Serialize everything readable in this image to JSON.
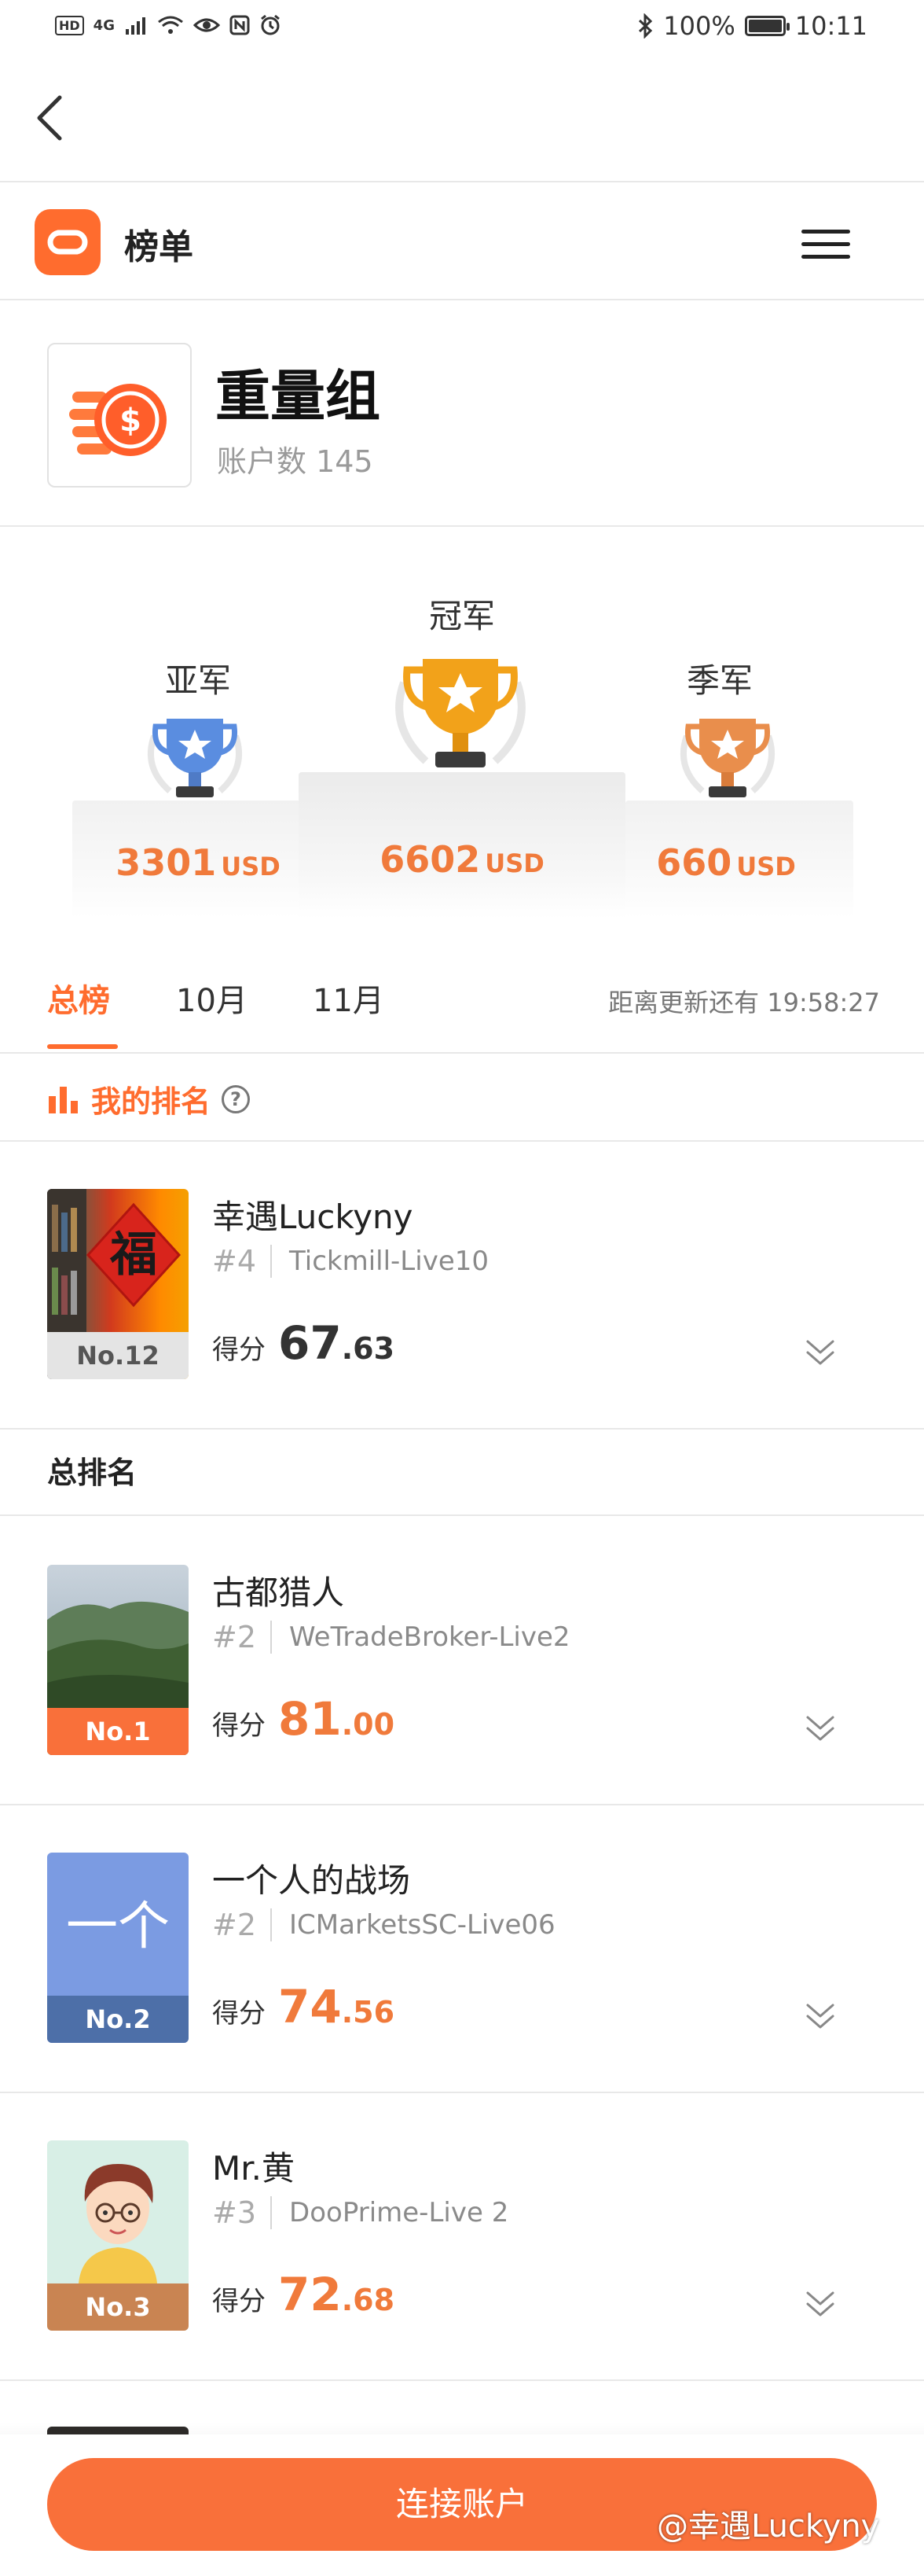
{
  "status_bar": {
    "left_chips": [
      "HD",
      "4G"
    ],
    "battery": "100%",
    "battery_level": 1.0,
    "time": "10:11"
  },
  "header": {
    "title": "榜单",
    "icons": {
      "back": "chevron-left-icon",
      "menu": "hamburger-menu-icon",
      "logo": "app-logo-icon"
    }
  },
  "group": {
    "name": "重量组",
    "account_count": "账户数 145",
    "icon": "dollar-coins-icon"
  },
  "podium": {
    "second": {
      "label": "亚军",
      "amount": "3301",
      "unit": "USD",
      "trophy_color": "#5a8de0"
    },
    "first": {
      "label": "冠军",
      "amount": "6602",
      "unit": "USD",
      "trophy_color": "#f2a21a"
    },
    "third": {
      "label": "季军",
      "amount": "660",
      "unit": "USD",
      "trophy_color": "#e98e4c"
    }
  },
  "tabs": [
    {
      "label": "总榜",
      "active": true
    },
    {
      "label": "10月",
      "active": false
    },
    {
      "label": "11月",
      "active": false
    }
  ],
  "countdown": "距离更新还有 19:58:27",
  "my_rank": {
    "label": "我的排名",
    "entry": {
      "name": "幸遇Luckyny",
      "rank_tag": "#4",
      "account": "Tickmill-Live10",
      "badge": "No.12",
      "score_label": "得分",
      "score_int": "67",
      "score_dec": ".63"
    }
  },
  "overall": {
    "label": "总排名",
    "entries": [
      {
        "name": "古都猎人",
        "rank_tag": "#2",
        "account": "WeTradeBroker-Live2",
        "badge": "No.1",
        "score_label": "得分",
        "score_int": "81",
        "score_dec": ".00",
        "badge_color": "#f9703a"
      },
      {
        "name": "一个人的战场",
        "rank_tag": "#2",
        "account": "ICMarketsSC-Live06",
        "badge": "No.2",
        "score_label": "得分",
        "score_int": "74",
        "score_dec": ".56",
        "badge_color": "#4d6fa8",
        "avatar_text": "一个"
      },
      {
        "name": "Mr.黄",
        "rank_tag": "#3",
        "account": "DooPrime-Live 2",
        "badge": "No.3",
        "score_label": "得分",
        "score_int": "72",
        "score_dec": ".68",
        "badge_color": "#c98452"
      }
    ]
  },
  "footer": {
    "connect_button": "连接账户",
    "watermark": "@幸遇Luckyny"
  },
  "colors": {
    "accent": "#f9703a",
    "score_orange": "#f07a3b"
  }
}
